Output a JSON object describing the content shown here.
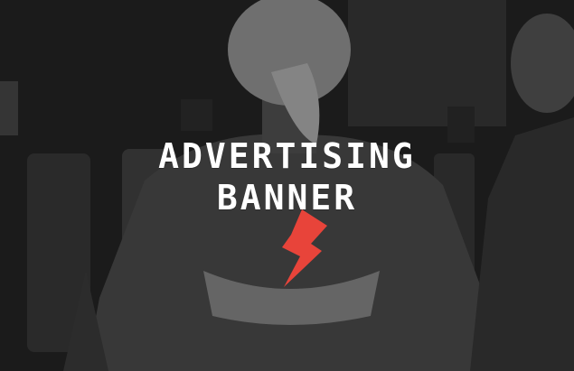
{
  "banner": {
    "title_line1": "ADVERTISING",
    "title_line2": "BANNER",
    "icon": "lightning-bolt-icon",
    "accent_color": "#e8443a"
  }
}
